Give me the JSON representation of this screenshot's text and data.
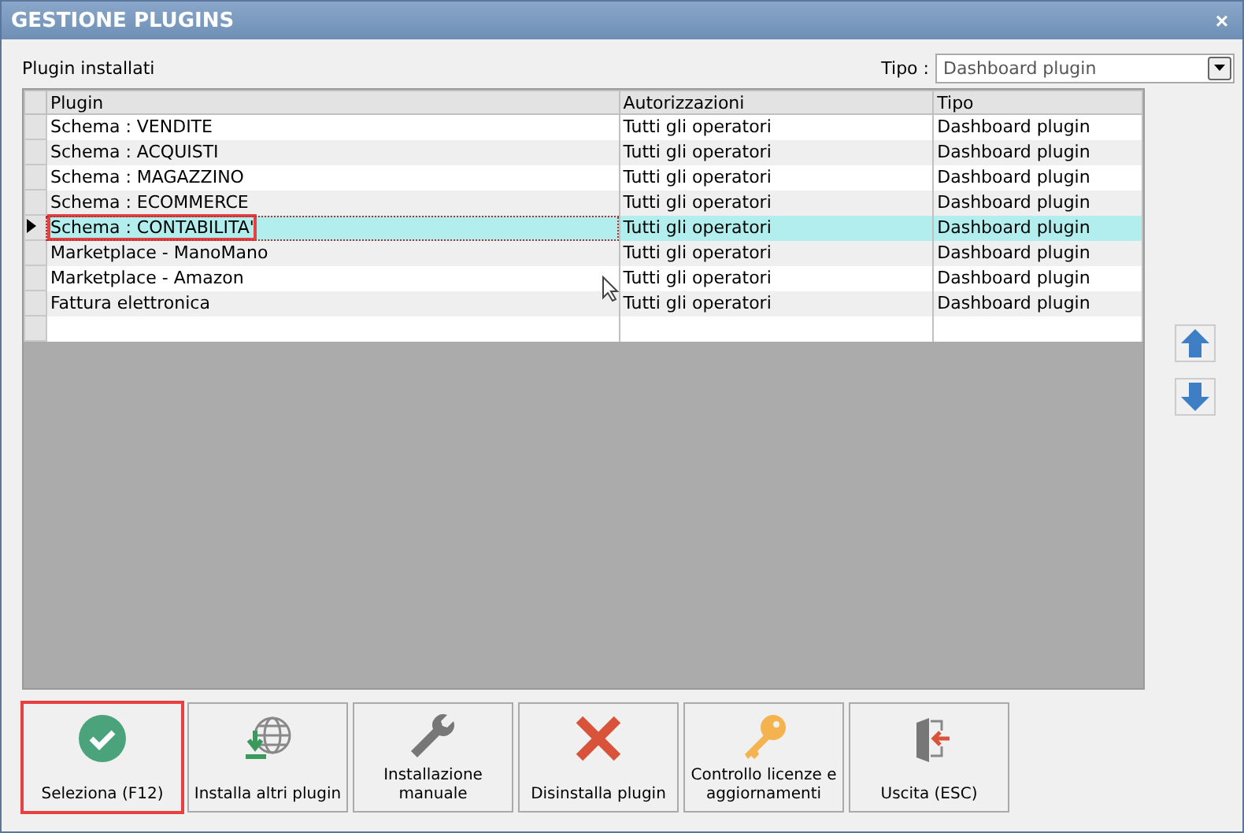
{
  "window": {
    "title": "GESTIONE PLUGINS",
    "close": "×"
  },
  "section_label": "Plugin installati",
  "filter": {
    "label": "Tipo :",
    "value": "Dashboard plugin"
  },
  "table": {
    "columns": [
      "Plugin",
      "Autorizzazioni",
      "Tipo"
    ],
    "rows": [
      {
        "cells": [
          "Schema : VENDITE",
          "Tutti gli operatori",
          "Dashboard plugin"
        ],
        "selected": false,
        "highlighted": false
      },
      {
        "cells": [
          "Schema : ACQUISTI",
          "Tutti gli operatori",
          "Dashboard plugin"
        ],
        "selected": false,
        "highlighted": false
      },
      {
        "cells": [
          "Schema : MAGAZZINO",
          "Tutti gli operatori",
          "Dashboard plugin"
        ],
        "selected": false,
        "highlighted": false
      },
      {
        "cells": [
          "Schema : ECOMMERCE",
          "Tutti gli operatori",
          "Dashboard plugin"
        ],
        "selected": false,
        "highlighted": false
      },
      {
        "cells": [
          "Schema : CONTABILITA'",
          "Tutti gli operatori",
          "Dashboard plugin"
        ],
        "selected": true,
        "highlighted": true
      },
      {
        "cells": [
          "Marketplace - ManoMano",
          "Tutti gli operatori",
          "Dashboard plugin"
        ],
        "selected": false,
        "highlighted": false
      },
      {
        "cells": [
          "Marketplace - Amazon",
          "Tutti gli operatori",
          "Dashboard plugin"
        ],
        "selected": false,
        "highlighted": false
      },
      {
        "cells": [
          "Fattura elettronica",
          "Tutti gli operatori",
          "Dashboard plugin"
        ],
        "selected": false,
        "highlighted": false
      }
    ]
  },
  "buttons": [
    {
      "label": "Seleziona (F12)",
      "kind": "check",
      "highlighted": true
    },
    {
      "label": "Installa altri plugin",
      "kind": "globe",
      "highlighted": false
    },
    {
      "label": "Installazione manuale",
      "kind": "wrench",
      "highlighted": false
    },
    {
      "label": "Disinstalla plugin",
      "kind": "cross",
      "highlighted": false
    },
    {
      "label": "Controllo licenze e aggiornamenti",
      "kind": "key",
      "highlighted": false
    },
    {
      "label": "Uscita (ESC)",
      "kind": "exit",
      "highlighted": false
    }
  ]
}
